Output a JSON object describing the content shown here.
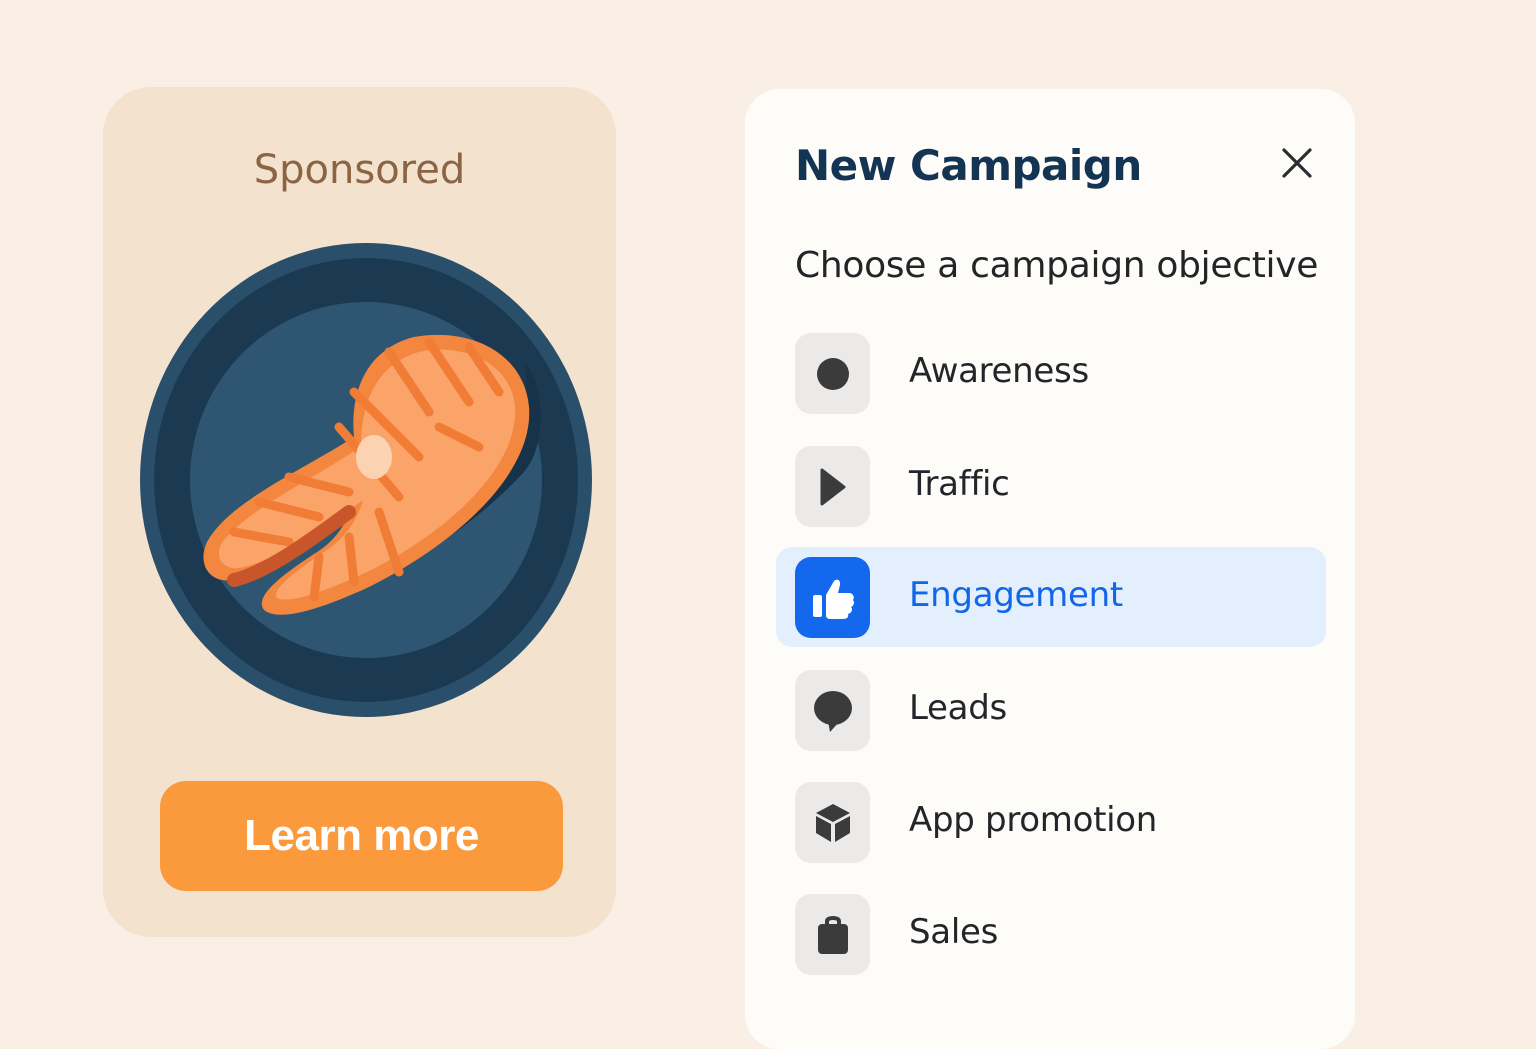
{
  "ad": {
    "sponsored_label": "Sponsored",
    "image_icon": "salmon-steak-on-plate",
    "cta_label": "Learn more",
    "cta_color": "#fb9a3c"
  },
  "panel": {
    "title": "New Campaign",
    "close_icon": "close-icon",
    "subtitle": "Choose a campaign objective",
    "selected": "Engagement",
    "options": [
      {
        "label": "Awareness",
        "icon": "circle-icon"
      },
      {
        "label": "Traffic",
        "icon": "play-icon"
      },
      {
        "label": "Engagement",
        "icon": "thumbs-up-icon"
      },
      {
        "label": "Leads",
        "icon": "speech-bubble-icon"
      },
      {
        "label": "App promotion",
        "icon": "cube-icon"
      },
      {
        "label": "Sales",
        "icon": "shopping-bag-icon"
      }
    ],
    "accent_color": "#1468ee"
  }
}
